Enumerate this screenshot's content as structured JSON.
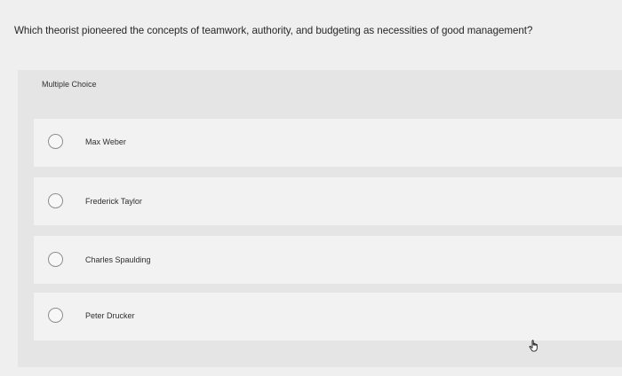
{
  "question": {
    "text": "Which theorist pioneered the concepts of teamwork, authority, and budgeting as necessities of good management?"
  },
  "answer_section": {
    "type_label": "Multiple Choice",
    "options": [
      {
        "label": "Max Weber",
        "selected": false
      },
      {
        "label": "Frederick Taylor",
        "selected": false
      },
      {
        "label": "Charles Spaulding",
        "selected": false
      },
      {
        "label": "Peter Drucker",
        "selected": false
      }
    ]
  },
  "icons": {
    "radio": "radio-unselected-icon",
    "cursor": "hand-pointer-icon"
  },
  "colors": {
    "page_bg": "#efeff0",
    "panel_bg": "#e5e5e6",
    "option_bg": "#f2f2f3",
    "radio_border": "#8e8e8e"
  }
}
